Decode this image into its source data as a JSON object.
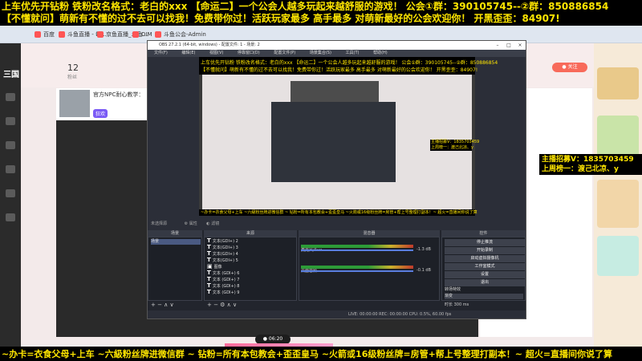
{
  "banner": {
    "line1": "上车优先开钻粉  铁粉改名格式：老白的xxx 【命运二】一个公会人越多玩起来越舒服的游戏！ 公会①群：390105745--②群：850886854",
    "line2": "【不懂就问】萌新有不懂的过不去可以找我！免费带你过！活跃玩家最多 高手最多 对萌新最好的公会欢迎你！  开黑歪歪：84907!"
  },
  "browser_tabs": [
    "百度",
    "斗鱼直播 - 每...",
    "京鱼直播_斗鱼...",
    "DIM",
    "斗鱼公会-Admin"
  ],
  "site": {
    "logo": "三国",
    "count": "12",
    "count_sub": "粉丝",
    "anchor_name": "官方NPC耐心教学：",
    "anchor_tag": "狂欢",
    "red_button": "● 关注"
  },
  "obs": {
    "title": "OBS 27.2.1 (64-bit, windows) - 配置文件: 1 - 场景: 2",
    "menu": [
      "文件(F)",
      "编辑(E)",
      "视图(V)",
      "停靠窗口(D)",
      "配置文件(P)",
      "场景集合(S)",
      "工具(T)",
      "帮助(H)"
    ],
    "preview_banner1": "上车优先开钻粉  铁粉改名格式：老白的xxx 【命运二】一个公会人越多玩起来越舒服的游戏！ 公会①群：390105745--②群：850886854",
    "preview_banner2": "【不懂就问】萌新有不懂的过不去可以找我！免费带你过！活跃玩家最多 高手最多 对萌新最好的公会欢迎你！  开黑歪歪：84907!",
    "preview_overlay1": "主播招募V：1835703459",
    "preview_overlay2": "上周榜一：渡己北凉、y",
    "preview_bottom": "~办卡=衣食父母+上车 ~六級粉丝牌进微信群 ~ 钻粉=所有本包教会+歪歪皇马 ~火箭或16级粉丝牌=房管+帮上号整理打副本！~ 超火=直播间你说了算",
    "toolbar_label": "未选择源",
    "toolbar_props": "属性",
    "toolbar_filters": "滤镜",
    "docks": {
      "scenes": "场景",
      "sources": "来源",
      "mixer": "混音器",
      "controls": "控件"
    },
    "scene_item": "场景",
    "sources": [
      "文本(GDI+) 2",
      "文本(GDI+) 3",
      "文本(GDI+) 4",
      "文本(GDI+) 5",
      "图像",
      "文本 (GDI+) 6",
      "文本 (GDI+) 7",
      "文本 (GDI+) 8",
      "文本 (GDI+) 9"
    ],
    "mixer": [
      {
        "name": "麦克风/Aux",
        "db": "-1.3 dB"
      },
      {
        "name": "桌面音频",
        "db": "-0.1 dB"
      }
    ],
    "controls": [
      "停止推流",
      "开始录制",
      "启动虚拟摄像机",
      "工作室模式",
      "设置",
      "退出"
    ],
    "transitions": "转场特效",
    "fade": "渐变",
    "duration_label": "时长",
    "duration_value": "300 ms",
    "status": "LIVE: 00:00:00   REC: 00:00:00   CPU: 0.5%, 60.00 fps"
  },
  "overlay_right": {
    "line1": "主播招募V：1835703459",
    "line2": "上周榜一：渡己北凉、y"
  },
  "timer": "● 06:20",
  "bottom_bar": "~办卡=衣食父母+上车 ~六級粉丝牌进微信群 ~ 钻粉=所有本包教会+歪歪皇马 ~火箭或16级粉丝牌=房管+帮上号整理打副本！~ 超火=直播间你说了算"
}
